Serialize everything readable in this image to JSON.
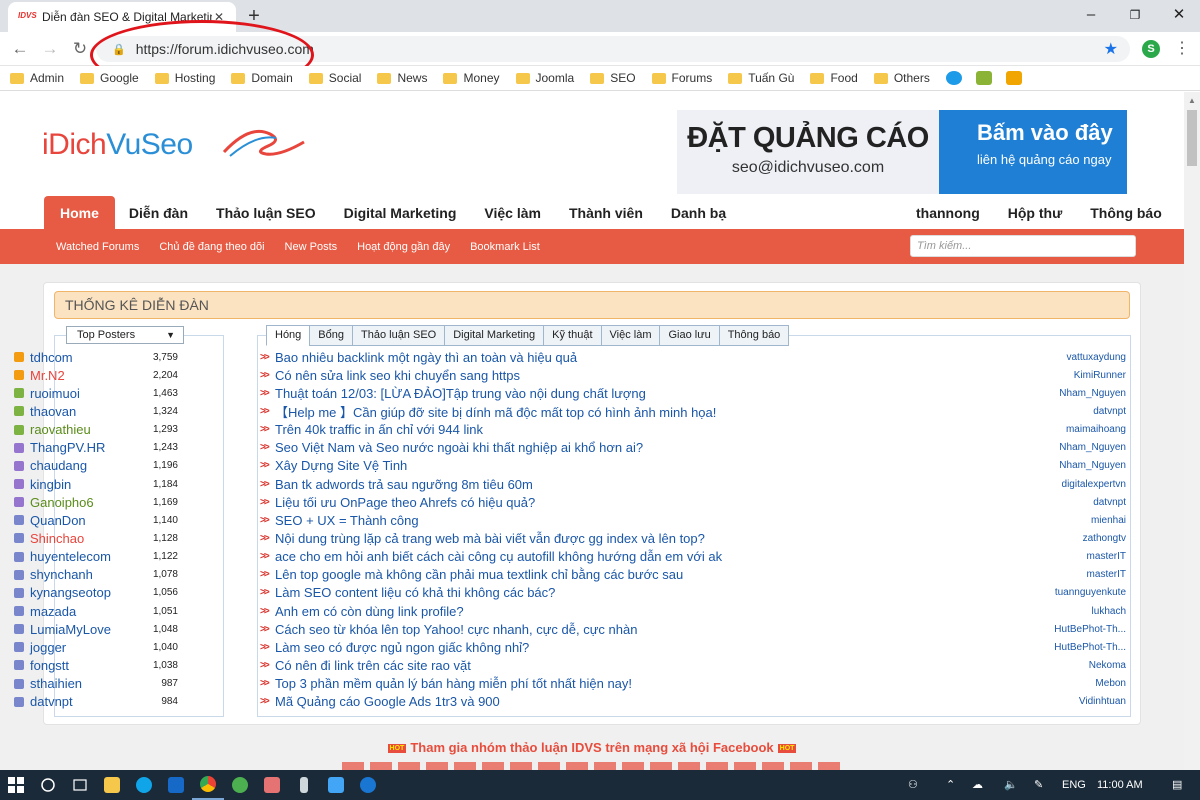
{
  "browser": {
    "tab_title": "Diễn đàn SEO & Digital Marketing",
    "tab_favicon_text": "IDVS",
    "url": "https://forum.idichvuseo.com",
    "bookmarks": [
      "Admin",
      "Google",
      "Hosting",
      "Domain",
      "Social",
      "News",
      "Money",
      "Joomla",
      "SEO",
      "Forums",
      "Tuấn Gù",
      "Food",
      "Others"
    ]
  },
  "site": {
    "logo_part1": "iDich",
    "logo_part2": "VuSeo",
    "ad": {
      "left_title": "ĐẶT QUẢNG CÁO",
      "left_email": "seo@idichvuseo.com",
      "right_title": "Bấm vào đây",
      "right_sub": "liên hệ quảng cáo ngay"
    },
    "nav": [
      "Home",
      "Diễn đàn",
      "Thảo luận SEO",
      "Digital Marketing",
      "Việc làm",
      "Thành viên",
      "Danh bạ"
    ],
    "user_nav": [
      "thannong",
      "Hộp thư",
      "Thông báo"
    ],
    "subnav": [
      "Watched Forums",
      "Chủ đề đang theo dõi",
      "New Posts",
      "Hoạt động gần đây",
      "Bookmark List"
    ],
    "search_placeholder": "Tìm kiếm...",
    "stats_title": "THỐNG KÊ DIỄN ĐÀN",
    "posters_select": "Top Posters",
    "posters": [
      {
        "name": "tdhcom",
        "count": "3,759",
        "color": "#1a57a8",
        "icon": "#f39c12"
      },
      {
        "name": "Mr.N2",
        "count": "2,204",
        "color": "#e8453c",
        "icon": "#f39c12"
      },
      {
        "name": "ruoimuoi",
        "count": "1,463",
        "color": "#1a57a8",
        "icon": "#7cb342"
      },
      {
        "name": "thaovan",
        "count": "1,324",
        "color": "#1a57a8",
        "icon": "#7cb342"
      },
      {
        "name": "raovathieu",
        "count": "1,293",
        "color": "#5a8c1a",
        "icon": "#7cb342"
      },
      {
        "name": "ThangPV.HR",
        "count": "1,243",
        "color": "#1a57a8",
        "icon": "#9575cd"
      },
      {
        "name": "chaudang",
        "count": "1,196",
        "color": "#1a57a8",
        "icon": "#9575cd"
      },
      {
        "name": "kingbin",
        "count": "1,184",
        "color": "#1a57a8",
        "icon": "#9575cd"
      },
      {
        "name": "Ganoipho6",
        "count": "1,169",
        "color": "#5a8c1a",
        "icon": "#9575cd"
      },
      {
        "name": "QuanDon",
        "count": "1,140",
        "color": "#1a57a8",
        "icon": "#7986cb"
      },
      {
        "name": "Shinchao",
        "count": "1,128",
        "color": "#e8453c",
        "icon": "#7986cb"
      },
      {
        "name": "huyentelecom",
        "count": "1,122",
        "color": "#1a57a8",
        "icon": "#7986cb"
      },
      {
        "name": "shynchanh",
        "count": "1,078",
        "color": "#1a57a8",
        "icon": "#7986cb"
      },
      {
        "name": "kynangseotop",
        "count": "1,056",
        "color": "#1a57a8",
        "icon": "#7986cb"
      },
      {
        "name": "mazada",
        "count": "1,051",
        "color": "#1a57a8",
        "icon": "#7986cb"
      },
      {
        "name": "LumiaMyLove",
        "count": "1,048",
        "color": "#1a57a8",
        "icon": "#7986cb"
      },
      {
        "name": "jogger",
        "count": "1,040",
        "color": "#1a57a8",
        "icon": "#7986cb"
      },
      {
        "name": "fongstt",
        "count": "1,038",
        "color": "#1a57a8",
        "icon": "#7986cb"
      },
      {
        "name": "sthaihien",
        "count": "987",
        "color": "#1a57a8",
        "icon": "#7986cb"
      },
      {
        "name": "datvnpt",
        "count": "984",
        "color": "#1a57a8",
        "icon": "#7986cb"
      }
    ],
    "topic_tabs": [
      "Hóng",
      "Bổng",
      "Thảo luận SEO",
      "Digital Marketing",
      "Kỹ thuật",
      "Việc làm",
      "Giao lưu",
      "Thông báo"
    ],
    "topics": [
      {
        "title": "Bao nhiêu backlink một ngày thì an toàn và hiệu quả",
        "author": "vattuxaydung"
      },
      {
        "title": "Có nên sửa link seo khi chuyển sang https",
        "author": "KimiRunner"
      },
      {
        "title": "Thuật toán 12/03: [LỪA ĐẢO]Tập trung vào nội dung chất lượng",
        "author": "Nham_Nguyen"
      },
      {
        "title": "【Help me 】Cần giúp đỡ site bị dính mã độc mất top có hình ảnh minh họa!",
        "author": "datvnpt"
      },
      {
        "title": "Trên 40k traffic in ấn chỉ với 944 link",
        "author": "maimaihoang"
      },
      {
        "title": "Seo Việt Nam và Seo nước ngoài khi thất nghiệp ai khổ hơn ai?",
        "author": "Nham_Nguyen"
      },
      {
        "title": "Xây Dựng Site Vệ Tinh",
        "author": "Nham_Nguyen"
      },
      {
        "title": "Ban tk adwords trả sau ngưỡng 8m tiêu 60m",
        "author": "digitalexpertvn"
      },
      {
        "title": "Liệu tối ưu OnPage theo Ahrefs có hiệu quả?",
        "author": "datvnpt"
      },
      {
        "title": "SEO + UX = Thành công",
        "author": "mienhai"
      },
      {
        "title": "Nội dung trùng lặp cả trang web mà bài viết vẫn được gg index và lên top?",
        "author": "zathongtv"
      },
      {
        "title": "ace cho em hỏi anh biết cách cài công cụ autofill không hướng dẫn em với ak",
        "author": "masterIT"
      },
      {
        "title": "Lên top google mà không cần phải mua textlink chỉ bằng các bước sau",
        "author": "masterIT"
      },
      {
        "title": "Làm SEO content liệu có khả thi không các bác?",
        "author": "tuannguyenkute"
      },
      {
        "title": "Anh em có còn dùng link profile?",
        "author": "lukhach"
      },
      {
        "title": "Cách seo từ khóa lên top Yahoo! cực nhanh, cực dễ, cực nhàn",
        "author": "HutBePhot-Th..."
      },
      {
        "title": "Làm seo có được ngủ ngon giấc không nhỉ?",
        "author": "HutBePhot-Th..."
      },
      {
        "title": "Có nên đi link trên các site rao vặt",
        "author": "Nekoma"
      },
      {
        "title": "Top 3 phần mềm quản lý bán hàng miễn phí tốt nhất hiện nay!",
        "author": "Mebon"
      },
      {
        "title": "Mã Quảng cáo Google Ads 1tr3 và 900",
        "author": "Vidinhtuan"
      }
    ],
    "promo": "Tham gia nhóm thảo luận IDVS trên mạng xã hội Facebook",
    "hot_badge": "HOT"
  },
  "taskbar": {
    "language": "ENG",
    "time": "11:00 AM"
  },
  "colors": {
    "accent": "#e75b44",
    "link": "#1a57a8",
    "highlight": "#e0151c"
  }
}
